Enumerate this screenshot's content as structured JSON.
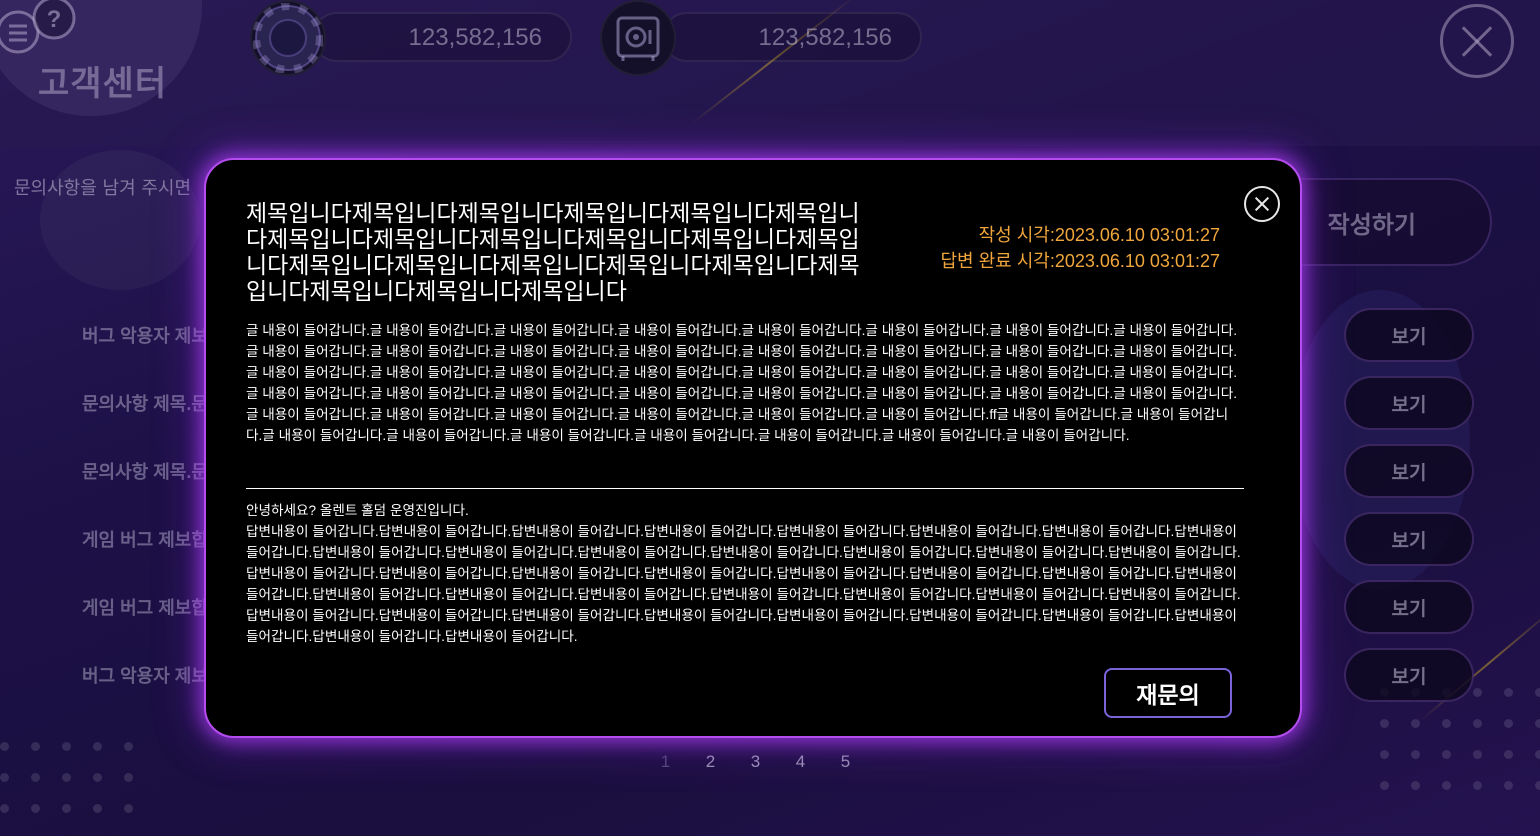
{
  "header": {
    "title": "고객센터",
    "chips_value": "123,582,156",
    "vault_value": "123,582,156"
  },
  "main": {
    "prompt": "문의사항을 남겨 주시면",
    "write_label": "작성하기",
    "items": [
      {
        "title": "버그 악용자 제보",
        "view_label": "보기"
      },
      {
        "title": "문의사항 제목.문",
        "view_label": "보기"
      },
      {
        "title": "문의사항 제목.문",
        "view_label": "보기"
      },
      {
        "title": "게임 버그 제보합",
        "view_label": "보기"
      },
      {
        "title": "게임 버그 제보합",
        "view_label": "보기"
      },
      {
        "title": "버그 악용자 제보",
        "view_label": "보기"
      }
    ],
    "pages": [
      "1",
      "2",
      "3",
      "4",
      "5"
    ]
  },
  "modal": {
    "title": "제목입니다제목입니다제목입니다제목입니다제목입니다제목입니다제목입니다제목입니다제목입니다제목입니다제목입니다제목입니다제목입니다제목입니다제목입니다제목입니다제목입니다제목입니다제목입니다제목입니다제목입니다",
    "created": "작성 시각:2023.06.10 03:01:27",
    "answered": "답변 완료 시각:2023.06.10 03:01:27",
    "body": "글 내용이 들어갑니다.글 내용이 들어갑니다.글 내용이 들어갑니다.글 내용이 들어갑니다.글 내용이 들어갑니다.글 내용이 들어갑니다.글 내용이 들어갑니다.글 내용이 들어갑니다.글 내용이 들어갑니다.글 내용이 들어갑니다.글 내용이 들어갑니다.글 내용이 들어갑니다.글 내용이 들어갑니다.글 내용이 들어갑니다.글 내용이 들어갑니다.글 내용이 들어갑니다.글 내용이 들어갑니다.글 내용이 들어갑니다.글 내용이 들어갑니다.글 내용이 들어갑니다.글 내용이 들어갑니다.글 내용이 들어갑니다.글 내용이 들어갑니다.글 내용이 들어갑니다.글 내용이 들어갑니다.글 내용이 들어갑니다.글 내용이 들어갑니다.글 내용이 들어갑니다.글 내용이 들어갑니다.글 내용이 들어갑니다.글 내용이 들어갑니다.글 내용이 들어갑니다.글 내용이 들어갑니다.글 내용이 들어갑니다.글 내용이 들어갑니다.글 내용이 들어갑니다.글 내용이 들어갑니다.글 내용이 들어갑니다.ff글 내용이 들어갑니다.글 내용이 들어갑니다.글 내용이 들어갑니다.글 내용이 들어갑니다.글 내용이 들어갑니다.글 내용이 들어갑니다.글 내용이 들어갑니다.글 내용이 들어갑니다.글 내용이 들어갑니다.",
    "greeting": "안녕하세요? 올렌트 홀덤 운영진입니다.",
    "answer": "답변내용이 들어갑니다.답변내용이 들어갑니다.답변내용이 들어갑니다.답변내용이 들어갑니다.답변내용이 들어갑니다.답변내용이 들어갑니다.답변내용이 들어갑니다.답변내용이 들어갑니다.답변내용이 들어갑니다.답변내용이 들어갑니다.답변내용이 들어갑니다.답변내용이 들어갑니다.답변내용이 들어갑니다.답변내용이 들어갑니다.답변내용이 들어갑니다.답변내용이 들어갑니다.답변내용이 들어갑니다.답변내용이 들어갑니다.답변내용이 들어갑니다.답변내용이 들어갑니다.답변내용이 들어갑니다.답변내용이 들어갑니다.답변내용이 들어갑니다.답변내용이 들어갑니다.답변내용이 들어갑니다.답변내용이 들어갑니다.답변내용이 들어갑니다.답변내용이 들어갑니다.답변내용이 들어갑니다.답변내용이 들어갑니다.답변내용이 들어갑니다.답변내용이 들어갑니다.답변내용이 들어갑니다.답변내용이 들어갑니다.답변내용이 들어갑니다.답변내용이 들어갑니다.답변내용이 들어갑니다.답변내용이 들어갑니다.답변내용이 들어갑니다.답변내용이 들어갑니다.",
    "reask_label": "재문의"
  },
  "colors": {
    "accent_glow": "#b54cf0",
    "timestamp": "#f0a63c",
    "reask_border": "#7a64d8"
  },
  "icons": {
    "support": "support-icon",
    "chip": "poker-chip-icon",
    "vault": "safe-icon",
    "close": "close-icon"
  }
}
